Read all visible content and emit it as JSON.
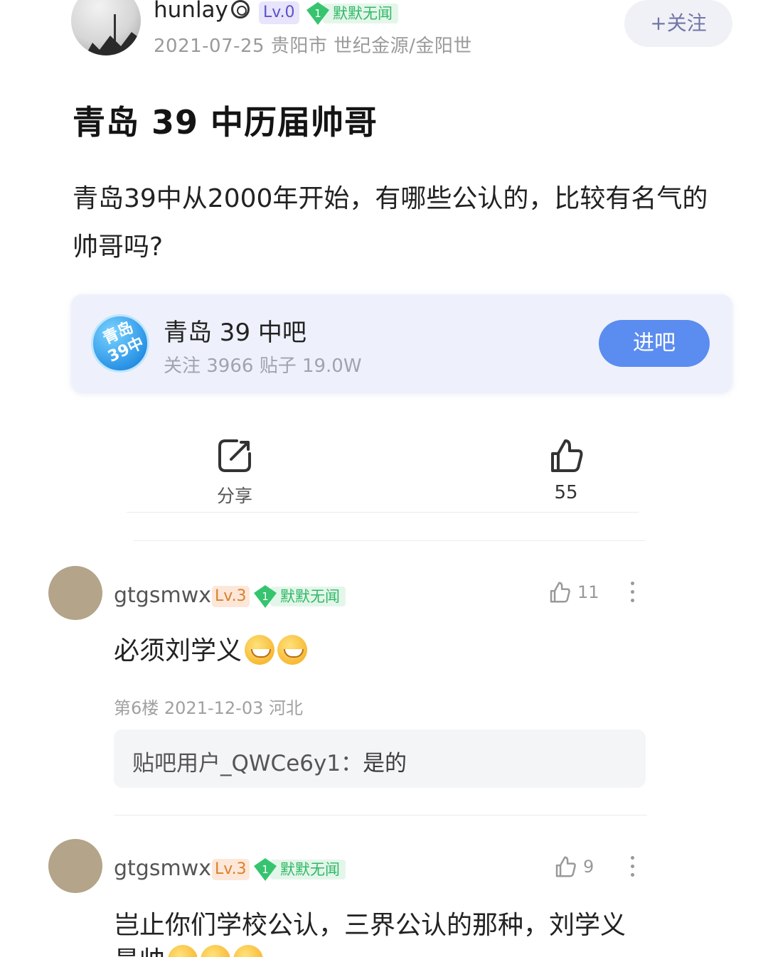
{
  "author": {
    "name": "hunlay",
    "level": "Lv.0",
    "medal_level": "1",
    "medal_title": "默默无闻",
    "date_location": "2021-07-25   贵阳市 世纪金源/金阳世",
    "follow_label": "+关注"
  },
  "post": {
    "title": "青岛 39 中历届帅哥",
    "body": "青岛39中从2000年开始，有哪些公认的，比较有名气的帅哥吗?"
  },
  "forum": {
    "logo_text": "青岛 39中",
    "name": "青岛 39 中吧",
    "stats": "关注 3966  贴子 19.0W",
    "enter_label": "进吧"
  },
  "actions": {
    "share_label": "分享",
    "like_count": "55"
  },
  "comments": [
    {
      "user": "gtgsmwx",
      "level": "Lv.3",
      "medal_level": "1",
      "medal_title": "默默无闻",
      "likes": "11",
      "text": "必须刘学义",
      "floor_info": "第6楼   2021-12-03   河北",
      "reply_user": "贴吧用户_QWCe6y1：",
      "reply_text": "是的"
    },
    {
      "user": "gtgsmwx",
      "level": "Lv.3",
      "medal_level": "1",
      "medal_title": "默默无闻",
      "likes": "9",
      "text": "岂止你们学校公认，三界公认的那种，刘学义",
      "text_line2": "最帅"
    }
  ],
  "colors": {
    "accent_blue": "#5b8cf0",
    "medal_green": "#2fb866",
    "lv3_orange": "#d9812e",
    "lv0_purple": "#5b53c8"
  }
}
